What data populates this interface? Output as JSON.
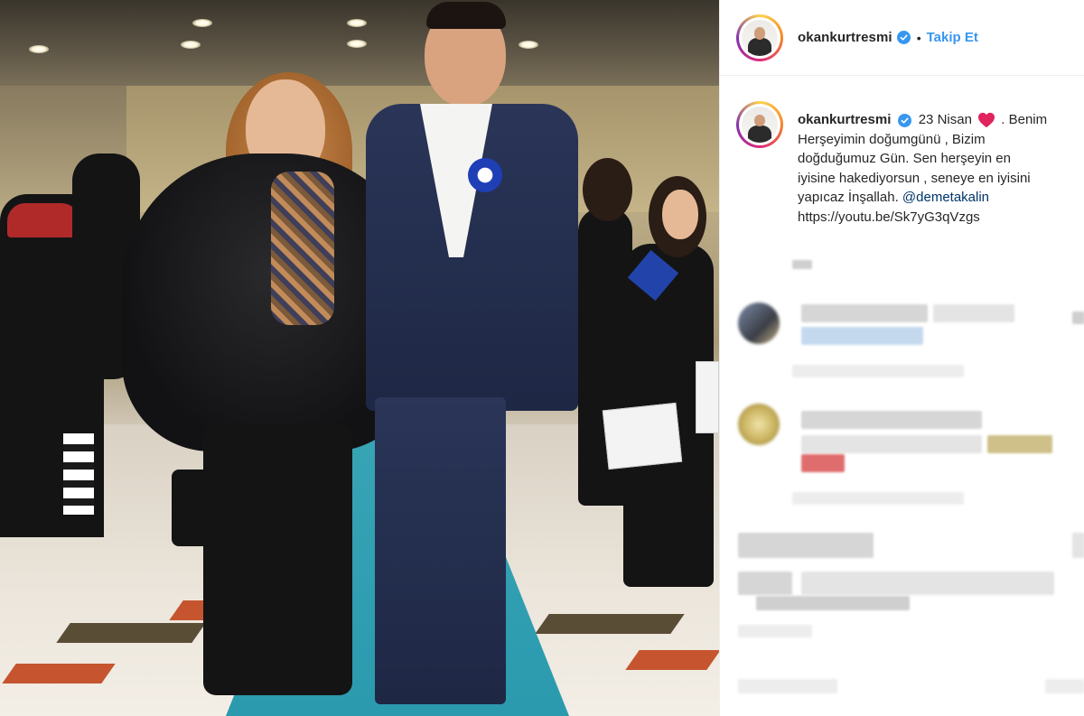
{
  "post": {
    "username": "okankurtresmi",
    "follow_label": "Takip Et",
    "separator": "•"
  },
  "caption": {
    "username": "okankurtresmi",
    "line1": "23 Nisan",
    "line1_end": ". Benim",
    "line2": "Herşeyimin doğumgünü , Bizim",
    "line3": "doğduğumuz Gün. Sen herşeyin en",
    "line4": "iyisine hakediyorsun , seneye en iyisini",
    "line5": "yapıcaz İnşallah.",
    "mention": "@demetakalin",
    "link": "https://youtu.be/Sk7yG3qVzgs"
  },
  "icons": {
    "verified": "verified-badge-icon",
    "heart": "red-heart-emoji"
  },
  "colors": {
    "link_blue": "#3897f0",
    "mention_blue": "#003569",
    "text": "#262626",
    "heart_red": "#e0245e"
  }
}
